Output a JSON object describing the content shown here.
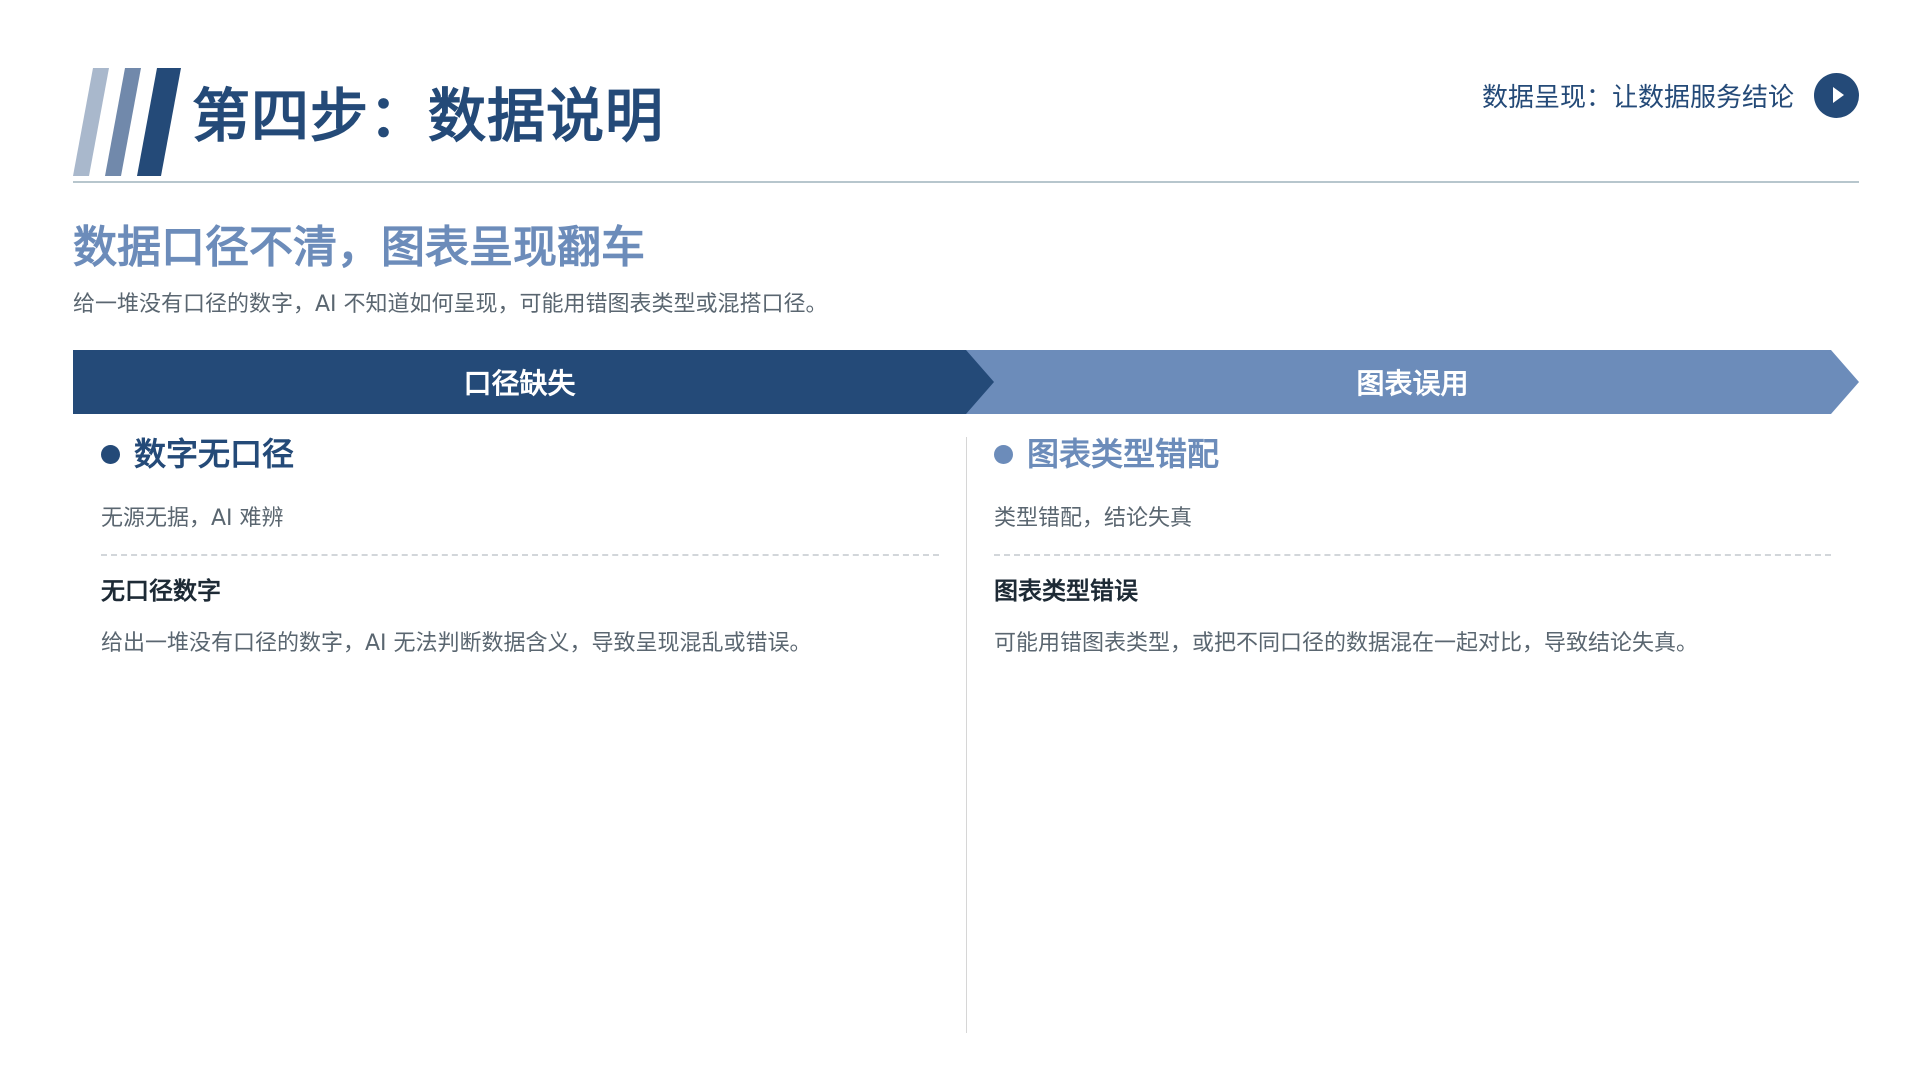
{
  "header": {
    "title": "第四步：数据说明",
    "subtitle": "数据呈现：让数据服务结论",
    "play_icon": "play-icon"
  },
  "section": {
    "title": "数据口径不清，图表呈现翻车",
    "description": "给一堆没有口径的数字，AI 不知道如何呈现，可能用错图表类型或混搭口径。"
  },
  "banner": {
    "left_label": "口径缺失",
    "right_label": "图表误用"
  },
  "columns": [
    {
      "heading": "数字无口径",
      "short": "无源无据，AI 难辨",
      "subheading": "无口径数字",
      "body": "给出一堆没有口径的数字，AI 无法判断数据含义，导致呈现混乱或错误。"
    },
    {
      "heading": "图表类型错配",
      "short": "类型错配，结论失真",
      "subheading": "图表类型错误",
      "body": "可能用错图表类型，或把不同口径的数据混在一起对比，导致结论失真。"
    }
  ],
  "colors": {
    "primary_dark": "#244a78",
    "primary_light": "#6c8cba",
    "stripe_pale": "#a9b8cc",
    "stripe_mid": "#7189ab",
    "text_gray": "#5a6670",
    "text_dark": "#1d2a35"
  }
}
